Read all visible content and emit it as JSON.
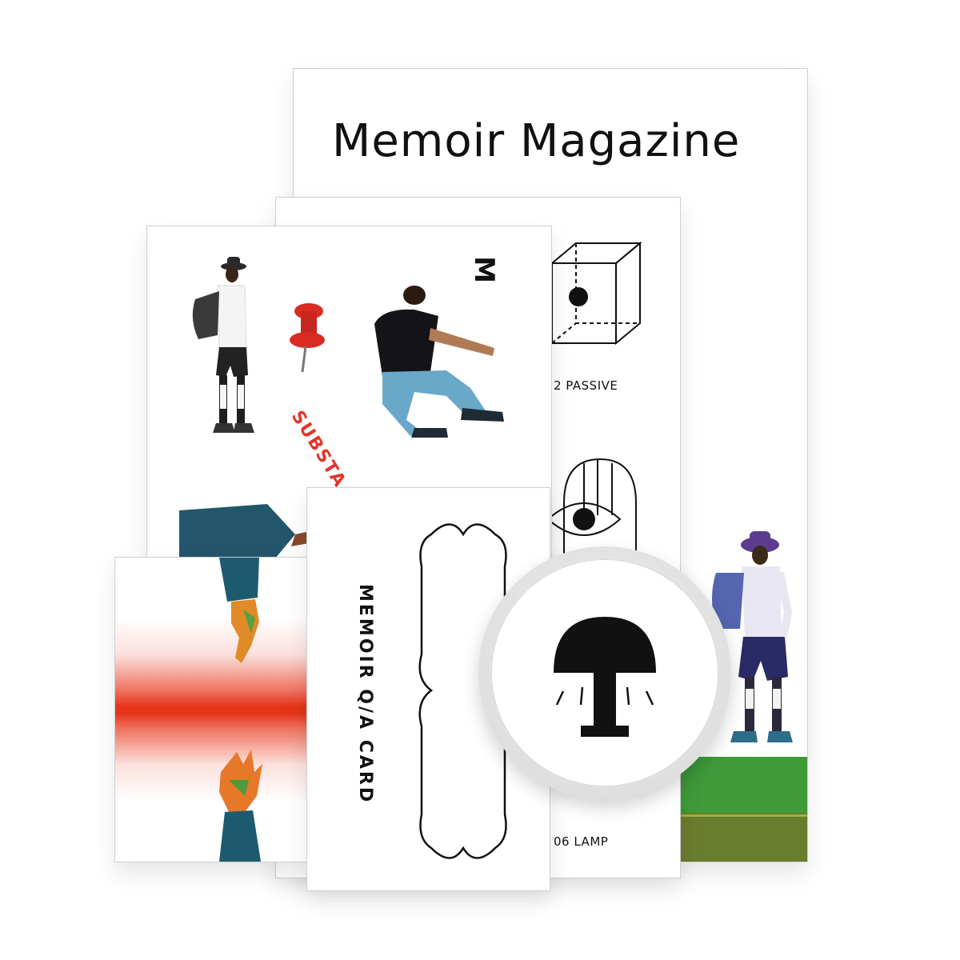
{
  "magazine": {
    "title": "Memoir Magazine"
  },
  "sticker_sheet": {
    "labels": [
      "2 PASSIVE",
      "06 LAMP"
    ],
    "icons": [
      "camera-cube-icon",
      "eye-arch-icon"
    ]
  },
  "postcard": {
    "logo": "M",
    "curved_text": "SUBSTA",
    "items": [
      "walking-man-photo",
      "pushpin-icon",
      "jumping-man-photo",
      "arm-photo"
    ]
  },
  "gradient_card": {
    "band_color": "#e5341a"
  },
  "qa_card": {
    "title": "MEMOIR Q/A CARD"
  },
  "badge": {
    "icon": "lamp-icon"
  },
  "colors": {
    "accent_red": "#e3362a",
    "ink": "#111111",
    "grass_green": "#3f9a3a"
  }
}
